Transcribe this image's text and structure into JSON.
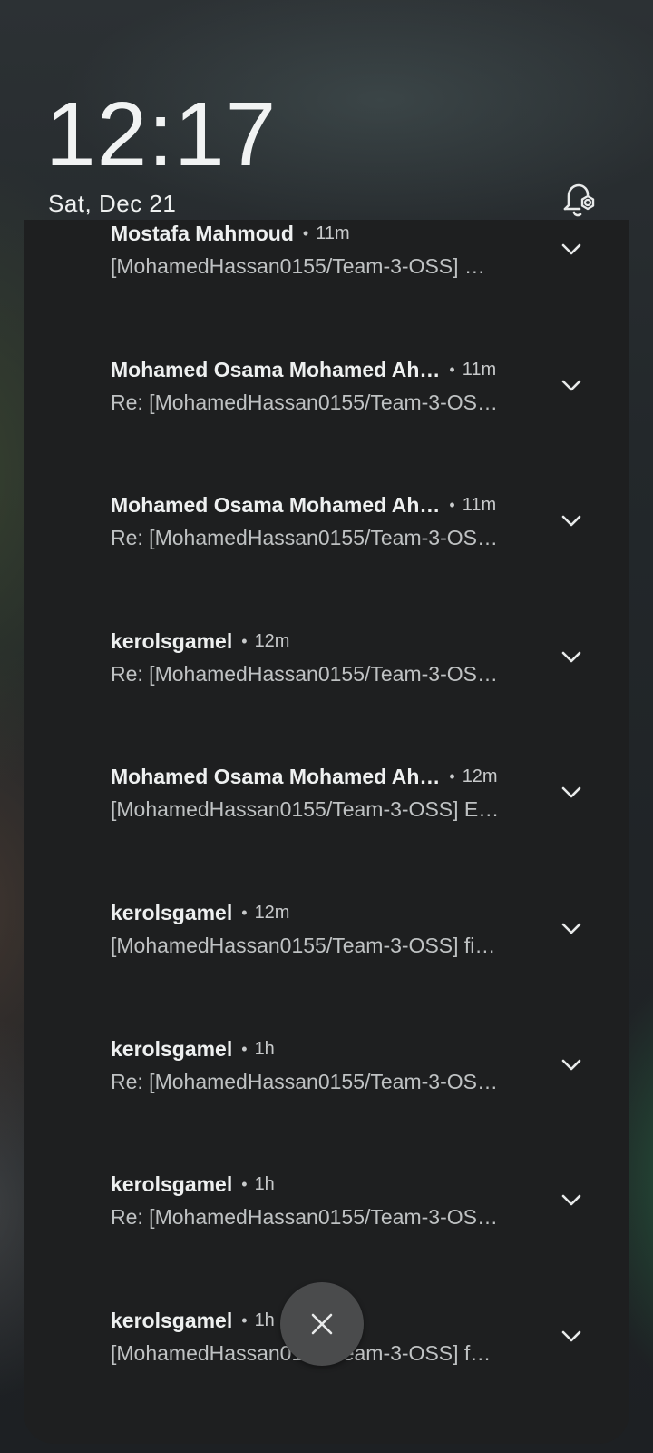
{
  "lockscreen": {
    "time": "12:17",
    "date": "Sat, Dec 21",
    "notification_settings_icon": "bell-gear-icon"
  },
  "notifications": [
    {
      "sender": "Mostafa Mahmoud",
      "time": "11m",
      "preview": "[MohamedHassan0155/Team-3-OSS] …"
    },
    {
      "sender": "Mohamed Osama Mohamed Ah…",
      "time": "11m",
      "preview": "Re: [MohamedHassan0155/Team-3-OS…"
    },
    {
      "sender": "Mohamed Osama Mohamed Ah…",
      "time": "11m",
      "preview": "Re: [MohamedHassan0155/Team-3-OS…"
    },
    {
      "sender": "kerolsgamel",
      "time": "12m",
      "preview": "Re: [MohamedHassan0155/Team-3-OS…"
    },
    {
      "sender": "Mohamed Osama Mohamed Ah…",
      "time": "12m",
      "preview": "[MohamedHassan0155/Team-3-OSS] E…"
    },
    {
      "sender": "kerolsgamel",
      "time": "12m",
      "preview": "[MohamedHassan0155/Team-3-OSS] fi…"
    },
    {
      "sender": "kerolsgamel",
      "time": "1h",
      "preview": "Re: [MohamedHassan0155/Team-3-OS…"
    },
    {
      "sender": "kerolsgamel",
      "time": "1h",
      "preview": "Re: [MohamedHassan0155/Team-3-OS…"
    },
    {
      "sender": "kerolsgamel",
      "time": "1h",
      "preview": "[MohamedHassan0155/Team-3-OSS] f…"
    }
  ],
  "separator": "•",
  "icons": {
    "expand": "chevron-down-icon",
    "clear_all": "close-icon"
  }
}
